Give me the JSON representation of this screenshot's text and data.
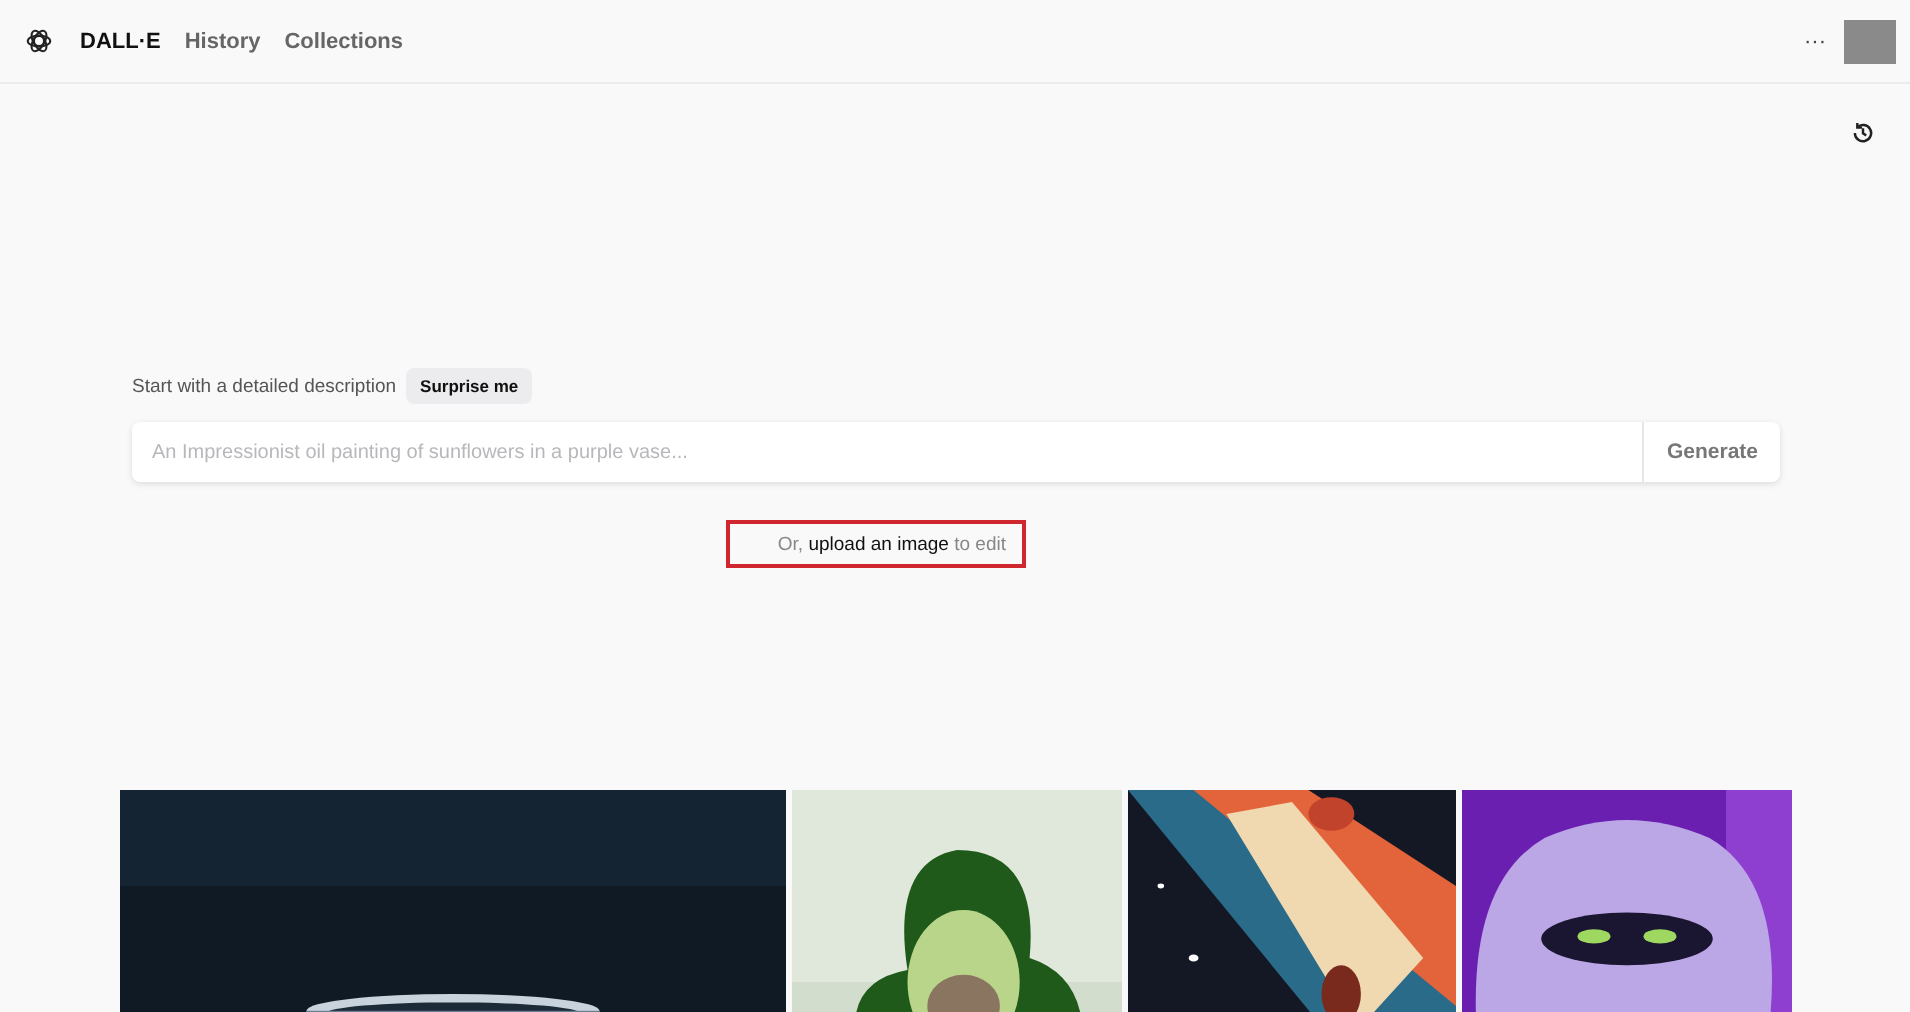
{
  "header": {
    "brand": "DALL·E",
    "nav": [
      {
        "label": "History",
        "selected": false
      },
      {
        "label": "Collections",
        "selected": false
      }
    ],
    "more": "···"
  },
  "prompt": {
    "label": "Start with a detailed description",
    "surprise": "Surprise me",
    "placeholder": "An Impressionist oil painting of sunflowers in a purple vase...",
    "generate": "Generate"
  },
  "upload": {
    "text": "Or, **upload an image** to edit",
    "highlighted": true
  }
}
